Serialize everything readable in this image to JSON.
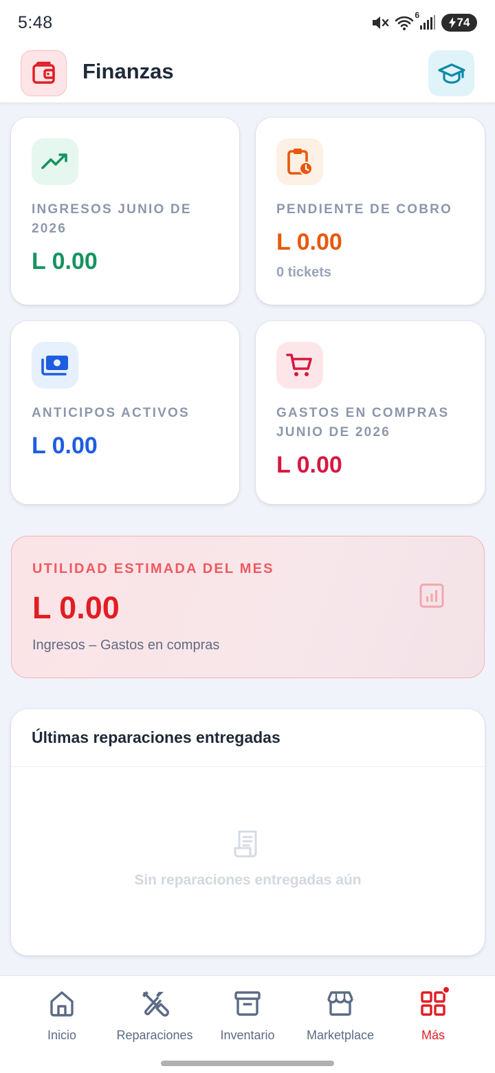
{
  "status_bar": {
    "time": "5:48",
    "wifi_label": "6",
    "battery": "74"
  },
  "header": {
    "title": "Finanzas",
    "logo_icon": "wallet-icon",
    "action_icon": "graduation-cap-icon"
  },
  "cards": {
    "income": {
      "label": "Ingresos junio de 2026",
      "value": "L 0.00",
      "icon": "trending-up-icon",
      "color": "#15935f"
    },
    "pending": {
      "label": "Pendiente de cobro",
      "value": "L 0.00",
      "sub": "0 tickets",
      "icon": "clipboard-clock-icon",
      "color": "#e8580c"
    },
    "advances": {
      "label": "Anticipos activos",
      "value": "L 0.00",
      "icon": "banknotes-icon",
      "color": "#1d5ee0"
    },
    "purchases": {
      "label": "Gastos en compras junio de 2026",
      "value": "L 0.00",
      "icon": "shopping-cart-icon",
      "color": "#d6193f"
    }
  },
  "utility": {
    "label": "UTILIDAD ESTIMADA DEL MES",
    "value": "L 0.00",
    "sub": "Ingresos – Gastos en compras",
    "icon": "bar-chart-icon"
  },
  "recent": {
    "title": "Últimas reparaciones entregadas",
    "empty_text": "Sin reparaciones entregadas aún",
    "empty_icon": "receipt-icon"
  },
  "nav": [
    {
      "label": "Inicio",
      "icon": "home-icon",
      "active": false
    },
    {
      "label": "Reparaciones",
      "icon": "tools-icon",
      "active": false
    },
    {
      "label": "Inventario",
      "icon": "archive-box-icon",
      "active": false
    },
    {
      "label": "Marketplace",
      "icon": "storefront-icon",
      "active": false
    },
    {
      "label": "Más",
      "icon": "grid-menu-icon",
      "active": true
    }
  ]
}
